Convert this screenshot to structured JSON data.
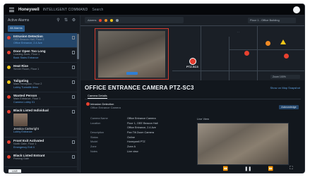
{
  "app": {
    "brand": "Honeywell",
    "product": "INTELLIGENT COMMAND",
    "breadcrumb": "Search"
  },
  "sidebar": {
    "title": "Active Alarms",
    "tabs": [
      "All Alarms"
    ],
    "items": [
      {
        "title": "Intrusion Detection",
        "lines": [
          "OEE Beacon Hall, Floor 2",
          "Office Entrance, 2.4 Ave"
        ],
        "priority": "red",
        "active": true
      },
      {
        "title": "Door Open Too Long",
        "lines": [
          "Loading Dock, Floor 1",
          "Back Stairs Entrance"
        ],
        "priority": "red"
      },
      {
        "title": "Heat Rise",
        "lines": [
          "Server Room, Floor 1"
        ],
        "priority": "yellow"
      },
      {
        "title": "Tailgating",
        "lines": [
          "Main Reception, Floor 2",
          "Lobby Turnstile Area"
        ],
        "priority": "yellow"
      },
      {
        "title": "Wanted Person",
        "lines": [
          "Main Entrance, Floor 1",
          "Camera Lobby 01"
        ],
        "priority": "red"
      },
      {
        "title": "Black Listed Individual",
        "lines": [],
        "priority": "red",
        "person": "Jessica Cartwright",
        "personLine": "Lobby Entrance"
      },
      {
        "title": "Front Exit Activated",
        "lines": [
          "North Gate, Floor 1",
          "Emergency Exit 4"
        ],
        "priority": "red"
      },
      {
        "title": "Black Listed Entrant",
        "lines": [
          "Parking Gate"
        ],
        "priority": "red"
      }
    ],
    "footer_chip": "LIVE"
  },
  "map": {
    "toolbar_label": "Alarms",
    "floor": "Floor 1 - Office Building",
    "camera_label": "PTZ-SC3",
    "zoom": "Zoom 100%"
  },
  "detail": {
    "title": "OFFICE ENTRANCE CAMERA PTZ-SC3",
    "links": "Show on Map   Snapshot",
    "tab": "Camera Details",
    "alert": "Intrusion Detection",
    "alert_sub": "Office Entrance Camera",
    "button": "Acknowledge",
    "fields": [
      {
        "k": "Camera Name",
        "v": "Office Entrance Camera"
      },
      {
        "k": "Location",
        "v": "Floor 1, OEE Beacon Hall"
      },
      {
        "k": "",
        "v": "Office Entrance, 2.4 Ave"
      },
      {
        "k": "Description",
        "v": "Pan Tilt Zoom Camera"
      },
      {
        "k": "Status",
        "v": "Online"
      },
      {
        "k": "Model",
        "v": "Honeywell PTZ"
      },
      {
        "k": "Zone",
        "v": "Zone A"
      },
      {
        "k": "Notes",
        "v": "Live view"
      }
    ],
    "video_label": "Live View"
  },
  "colors": {
    "red": "#e8412f",
    "orange": "#f08a24",
    "yellow": "#f2c618",
    "accent": "#2f7fd6"
  }
}
